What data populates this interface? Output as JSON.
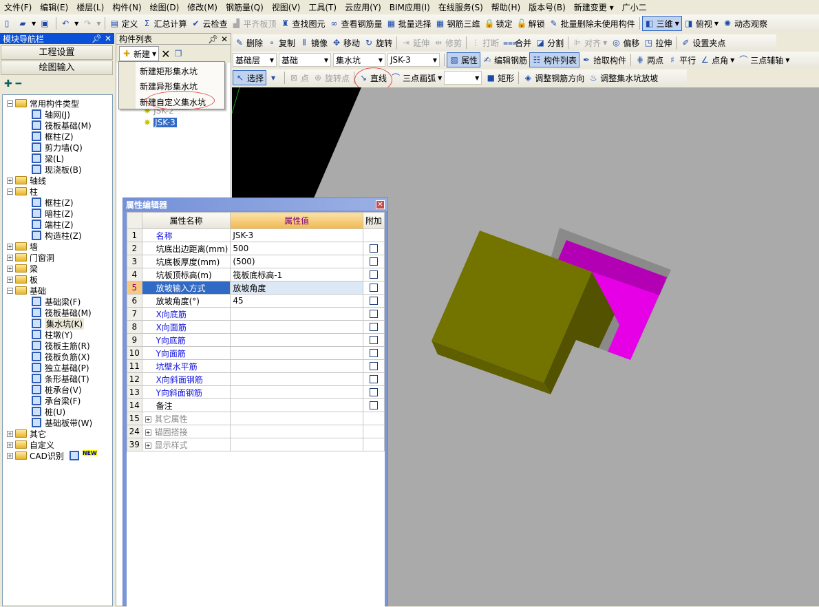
{
  "menu": [
    "文件(F)",
    "编辑(E)",
    "楼层(L)",
    "构件(N)",
    "绘图(D)",
    "修改(M)",
    "钢筋量(Q)",
    "视图(V)",
    "工具(T)",
    "云应用(Y)",
    "BIM应用(I)",
    "在线服务(S)",
    "帮助(H)",
    "版本号(B)",
    "新建变更 ▾",
    "广小二"
  ],
  "toolbar_main": [
    {
      "icon": "new-file",
      "g": "▯"
    },
    {
      "icon": "open-folder",
      "g": "▰",
      "dd": true
    },
    {
      "icon": "save",
      "g": "▣"
    },
    {
      "sep": true
    },
    {
      "icon": "undo",
      "g": "↶",
      "dd": true
    },
    {
      "icon": "redo",
      "g": "↷",
      "dd": true,
      "dis": true
    },
    {
      "sep": true
    },
    {
      "icon": "define",
      "g": "▤",
      "label": "定义"
    },
    {
      "icon": "sigma",
      "g": "Σ",
      "label": "汇总计算"
    },
    {
      "icon": "cloud-check",
      "g": "✔",
      "label": "云检查"
    },
    {
      "icon": "level-slab",
      "g": "▟",
      "label": "平齐板顶",
      "dis": true
    },
    {
      "icon": "binoculars",
      "g": "♜",
      "label": "查找图元"
    },
    {
      "icon": "glasses",
      "g": "∞",
      "label": "查看钢筋量"
    },
    {
      "icon": "batch-select",
      "g": "▦",
      "label": "批量选择"
    },
    {
      "icon": "rebar-3d",
      "g": "▦",
      "label": "钢筋三维"
    },
    {
      "icon": "lock",
      "g": "🔒",
      "label": "锁定"
    },
    {
      "icon": "unlock",
      "g": "🔓",
      "label": "解锁"
    },
    {
      "icon": "brush",
      "g": "✎",
      "label": "批量删除未使用构件"
    },
    {
      "sep": true
    },
    {
      "icon": "cube",
      "g": "◧",
      "label": "三维",
      "dd": true,
      "act": true
    },
    {
      "icon": "top-view",
      "g": "◨",
      "label": "俯视",
      "dd": true
    },
    {
      "icon": "orbit",
      "g": "✺",
      "label": "动态观察"
    }
  ],
  "toolbar_edit": [
    {
      "icon": "delete",
      "g": "✎",
      "label": "删除"
    },
    {
      "icon": "copy",
      "g": "∘",
      "label": "复制"
    },
    {
      "icon": "mirror",
      "g": "⫴",
      "label": "镜像"
    },
    {
      "icon": "move",
      "g": "✥",
      "label": "移动"
    },
    {
      "icon": "rotate",
      "g": "↻",
      "label": "旋转"
    },
    {
      "sep": true
    },
    {
      "icon": "extend",
      "g": "⇥",
      "label": "延伸",
      "dis": true
    },
    {
      "icon": "trim",
      "g": "⇹",
      "label": "修剪",
      "dis": true
    },
    {
      "sep": true
    },
    {
      "icon": "break",
      "g": "⋮",
      "label": "打断",
      "dis": true
    },
    {
      "icon": "merge",
      "g": "⩶",
      "label": "合并"
    },
    {
      "icon": "split",
      "g": "◪",
      "label": "分割"
    },
    {
      "sep": true
    },
    {
      "icon": "align",
      "g": "⊫",
      "label": "对齐",
      "dd": true,
      "dis": true
    },
    {
      "icon": "offset",
      "g": "◎",
      "label": "偏移"
    },
    {
      "icon": "stretch",
      "g": "◳",
      "label": "拉伸"
    },
    {
      "sep": true
    },
    {
      "icon": "grip-point",
      "g": "✐",
      "label": "设置夹点"
    }
  ],
  "toolbar_layer": {
    "combos": [
      "基础层",
      "基础",
      "集水坑",
      "JSK-3"
    ],
    "items": [
      {
        "icon": "properties",
        "g": "▧",
        "label": "属性",
        "act": true
      },
      {
        "icon": "edit-rebar",
        "g": "✍",
        "label": "编辑钢筋"
      },
      {
        "icon": "component-list",
        "g": "☷",
        "label": "构件列表",
        "act": true
      },
      {
        "icon": "pick",
        "g": "✒",
        "label": "拾取构件"
      },
      {
        "sep": true
      },
      {
        "icon": "two-point",
        "g": "⋕",
        "label": "两点"
      },
      {
        "icon": "parallel",
        "g": "♯",
        "label": "平行"
      },
      {
        "icon": "point-angle",
        "g": "∠",
        "label": "点角",
        "dd": true
      },
      {
        "icon": "three-point-axis",
        "g": "⌒",
        "label": "三点辅轴",
        "dd": true
      }
    ]
  },
  "toolbar_draw": [
    {
      "icon": "cursor",
      "g": "↖",
      "label": "选择",
      "act": true
    },
    {
      "icon": "dropdown",
      "g": "▾"
    },
    {
      "sep": true
    },
    {
      "icon": "point",
      "g": "⊠",
      "label": "点",
      "dis": true
    },
    {
      "icon": "rotate-point",
      "g": "⊕",
      "label": "旋转点",
      "dis": true
    },
    {
      "sep": true
    },
    {
      "icon": "line",
      "g": "↘",
      "label": "直线"
    },
    {
      "icon": "arc",
      "g": "⌒",
      "label": "三点画弧",
      "dd": true
    },
    {
      "combo": ""
    },
    {
      "icon": "rectangle",
      "g": "■",
      "label": "矩形"
    },
    {
      "sep": true
    },
    {
      "icon": "rebar-direction",
      "g": "◈",
      "label": "调整钢筋方向"
    },
    {
      "icon": "pit-slope",
      "g": "♨",
      "label": "调整集水坑放坡"
    }
  ],
  "nav": {
    "title": "模块导航栏",
    "buttons": [
      "工程设置",
      "绘图输入"
    ],
    "tree": [
      {
        "t": "常用构件类型",
        "f": 1,
        "open": 1
      },
      {
        "t": "轴网(J)",
        "l": 1
      },
      {
        "t": "筏板基础(M)",
        "l": 1
      },
      {
        "t": "框柱(Z)",
        "l": 1
      },
      {
        "t": "剪力墙(Q)",
        "l": 1
      },
      {
        "t": "梁(L)",
        "l": 1
      },
      {
        "t": "现浇板(B)",
        "l": 1
      },
      {
        "t": "轴线",
        "f": 1
      },
      {
        "t": "柱",
        "f": 1,
        "open": 1
      },
      {
        "t": "框柱(Z)",
        "l": 1
      },
      {
        "t": "暗柱(Z)",
        "l": 1
      },
      {
        "t": "端柱(Z)",
        "l": 1
      },
      {
        "t": "构造柱(Z)",
        "l": 1
      },
      {
        "t": "墙",
        "f": 1
      },
      {
        "t": "门窗洞",
        "f": 1
      },
      {
        "t": "梁",
        "f": 1
      },
      {
        "t": "板",
        "f": 1
      },
      {
        "t": "基础",
        "f": 1,
        "open": 1
      },
      {
        "t": "基础梁(F)",
        "l": 1
      },
      {
        "t": "筏板基础(M)",
        "l": 1
      },
      {
        "t": "集水坑(K)",
        "l": 1,
        "sel": 1
      },
      {
        "t": "柱墩(Y)",
        "l": 1
      },
      {
        "t": "筏板主筋(R)",
        "l": 1
      },
      {
        "t": "筏板负筋(X)",
        "l": 1
      },
      {
        "t": "独立基础(P)",
        "l": 1
      },
      {
        "t": "条形基础(T)",
        "l": 1
      },
      {
        "t": "桩承台(V)",
        "l": 1
      },
      {
        "t": "承台梁(F)",
        "l": 1
      },
      {
        "t": "桩(U)",
        "l": 1
      },
      {
        "t": "基础板带(W)",
        "l": 1
      },
      {
        "t": "其它",
        "f": 1
      },
      {
        "t": "自定义",
        "f": 1
      },
      {
        "t": "CAD识别",
        "f": 1,
        "badge": "NEW"
      }
    ]
  },
  "component_list": {
    "title": "构件列表",
    "new_label": "新建",
    "menu": [
      "新建矩形集水坑",
      "新建异形集水坑",
      "新建自定义集水坑"
    ],
    "items": [
      "JSK-2",
      "JSK-3"
    ],
    "selected": "JSK-3"
  },
  "prop_editor": {
    "title": "属性编辑器",
    "headers": [
      "属性名称",
      "属性值",
      "附加"
    ],
    "rows": [
      {
        "n": "1",
        "name": "名称",
        "value": "JSK-3",
        "blue": 1,
        "cb": 0
      },
      {
        "n": "2",
        "name": "坑底出边距离(mm)",
        "value": "500",
        "cb": 1
      },
      {
        "n": "3",
        "name": "坑底板厚度(mm)",
        "value": "(500)",
        "cb": 1
      },
      {
        "n": "4",
        "name": "坑板顶标高(m)",
        "value": "筏板底标高-1",
        "cb": 1
      },
      {
        "n": "5",
        "name": "放坡输入方式",
        "value": "放坡角度",
        "cb": 1,
        "sel": 1
      },
      {
        "n": "6",
        "name": "放坡角度(°)",
        "value": "45",
        "cb": 1
      },
      {
        "n": "7",
        "name": "X向底筋",
        "value": "",
        "blue": 1,
        "cb": 1
      },
      {
        "n": "8",
        "name": "X向面筋",
        "value": "",
        "blue": 1,
        "cb": 1
      },
      {
        "n": "9",
        "name": "Y向底筋",
        "value": "",
        "blue": 1,
        "cb": 1
      },
      {
        "n": "10",
        "name": "Y向面筋",
        "value": "",
        "blue": 1,
        "cb": 1
      },
      {
        "n": "11",
        "name": "坑壁水平筋",
        "value": "",
        "blue": 1,
        "cb": 1
      },
      {
        "n": "12",
        "name": "X向斜面钢筋",
        "value": "",
        "blue": 1,
        "cb": 1
      },
      {
        "n": "13",
        "name": "Y向斜面钢筋",
        "value": "",
        "blue": 1,
        "cb": 1
      },
      {
        "n": "14",
        "name": "备注",
        "value": "",
        "cb": 1
      },
      {
        "n": "15",
        "name": "其它属性",
        "value": "",
        "group": 1
      },
      {
        "n": "24",
        "name": "锚固搭接",
        "value": "",
        "group": 1
      },
      {
        "n": "39",
        "name": "显示样式",
        "value": "",
        "group": 1
      }
    ]
  },
  "colors": {
    "title_blue": "#0a50d8",
    "selection": "#316ac5",
    "viewport_bg": "#aaaaaa",
    "pit_olive": "#737300",
    "pit_magenta": "#e600e6",
    "header_value": "#f4c56a"
  }
}
